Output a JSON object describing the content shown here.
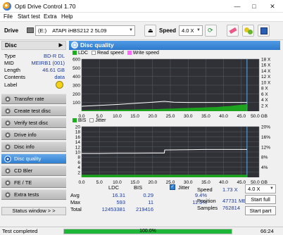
{
  "window": {
    "title": "Opti Drive Control 1.70"
  },
  "menu": [
    "File",
    "Start test",
    "Extra",
    "Help"
  ],
  "drivebar": {
    "drive_label": "Drive",
    "drive_letter": "(E:)",
    "drive_name": "ATAPI iHBS212  2 5L09",
    "speed_label": "Speed",
    "speed_value": "4.0 X"
  },
  "disc": {
    "header": "Disc",
    "fields": [
      {
        "label": "Type",
        "value": "BD-R DL"
      },
      {
        "label": "MID",
        "value": "MEIRB1 (001)"
      },
      {
        "label": "Length",
        "value": "46.61 GB"
      },
      {
        "label": "Contents",
        "value": "data"
      },
      {
        "label": "Label",
        "value": ""
      }
    ]
  },
  "nav": [
    "Transfer rate",
    "Create test disc",
    "Verify test disc",
    "Drive info",
    "Disc info",
    "Disc quality",
    "CD Bler",
    "FE / TE",
    "Extra tests"
  ],
  "nav_active": "Disc quality",
  "status_window_btn": "Status window > >",
  "panel": {
    "title": "Disc quality"
  },
  "chart_data": [
    {
      "type": "line",
      "legend": [
        "LDC",
        "Read speed",
        "Write speed"
      ],
      "x_ticks": [
        "0.0",
        "5.0",
        "10.0",
        "15.0",
        "20.0",
        "25.0",
        "30.0",
        "35.0",
        "40.0",
        "45.0",
        "50.0 GB"
      ],
      "y_left_ticks": [
        "100",
        "200",
        "300",
        "400",
        "500",
        "600"
      ],
      "y_right_ticks": [
        "2 X",
        "4 X",
        "6 X",
        "8 X",
        "10 X",
        "12 X",
        "14 X",
        "16 X",
        "18 X"
      ],
      "xlim": [
        0,
        50
      ],
      "ylim": [
        0,
        600
      ],
      "series": [
        {
          "name": "LDC",
          "x": [
            0,
            2,
            4,
            6,
            8,
            10,
            12,
            14,
            16,
            18,
            20,
            22,
            24,
            26,
            28,
            30,
            32,
            34,
            36,
            38,
            40,
            42,
            44,
            46.6
          ],
          "y": [
            10,
            12,
            14,
            14,
            15,
            16,
            18,
            18,
            20,
            22,
            23,
            25,
            28,
            30,
            34,
            36,
            40,
            42,
            46,
            48,
            55,
            60,
            70,
            80
          ]
        },
        {
          "name": "Read speed",
          "x": [
            0,
            5,
            10,
            15,
            20,
            23.3,
            26,
            30,
            35,
            40,
            46.6
          ],
          "y": [
            1.7,
            2.0,
            2.3,
            2.7,
            3.1,
            3.4,
            3.1,
            3.0,
            3.0,
            3.0,
            3.0
          ]
        }
      ]
    },
    {
      "type": "line",
      "legend": [
        "BIS",
        "Jitter"
      ],
      "x_ticks": [
        "0.0",
        "5.0",
        "10.0",
        "15.0",
        "20.0",
        "25.0",
        "30.0",
        "35.0",
        "40.0",
        "45.0",
        "50.0 GB"
      ],
      "y_left_ticks": [
        "2",
        "4",
        "6",
        "8",
        "10",
        "12",
        "14",
        "16",
        "18",
        "20"
      ],
      "y_right_ticks": [
        "4%",
        "8%",
        "12%",
        "16%",
        "20%"
      ],
      "xlim": [
        0,
        50
      ],
      "ylim": [
        0,
        20
      ],
      "series": [
        {
          "name": "BIS",
          "x": [
            0,
            5,
            10,
            15,
            20,
            25,
            30,
            35,
            40,
            45,
            46.6
          ],
          "y": [
            1,
            1,
            1,
            1,
            1,
            1,
            1,
            1,
            1,
            1,
            1
          ]
        },
        {
          "name": "Jitter",
          "x": [
            0,
            5,
            10,
            15,
            20,
            23.3,
            23.4,
            30,
            35,
            40,
            46.6
          ],
          "y": [
            9.4,
            9.4,
            9.5,
            9.5,
            9.6,
            9.6,
            10.8,
            10.9,
            11.0,
            11.0,
            11.0
          ]
        }
      ]
    }
  ],
  "stats": {
    "col_ldc": "LDC",
    "col_bis": "BIS",
    "rows": [
      {
        "label": "Avg",
        "ldc": "16.31",
        "bis": "0.29"
      },
      {
        "label": "Max",
        "ldc": "593",
        "bis": "11"
      },
      {
        "label": "Total",
        "ldc": "12453381",
        "bis": "219416"
      }
    ],
    "jitter_label": "Jitter",
    "jitter_avg": "9.4%",
    "jitter_max": "11.6%",
    "speed_label": "Speed",
    "speed_value": "1.73 X",
    "position_label": "Position",
    "position_value": "47731 MB",
    "samples_label": "Samples",
    "samples_value": "762814",
    "speed_select": "4.0 X",
    "start_full": "Start full",
    "start_part": "Start part"
  },
  "status": {
    "text": "Test completed",
    "progress_percent": 100,
    "progress_text": "100.0%",
    "time": "66:24"
  },
  "colors": {
    "accent": "#2f7fd2",
    "ldc": "#1db01d",
    "read_speed": "#ffffff",
    "write_speed": "#ff66ff",
    "bis": "#1db01d",
    "jitter": "#ffffff",
    "progress": "#1db638"
  }
}
